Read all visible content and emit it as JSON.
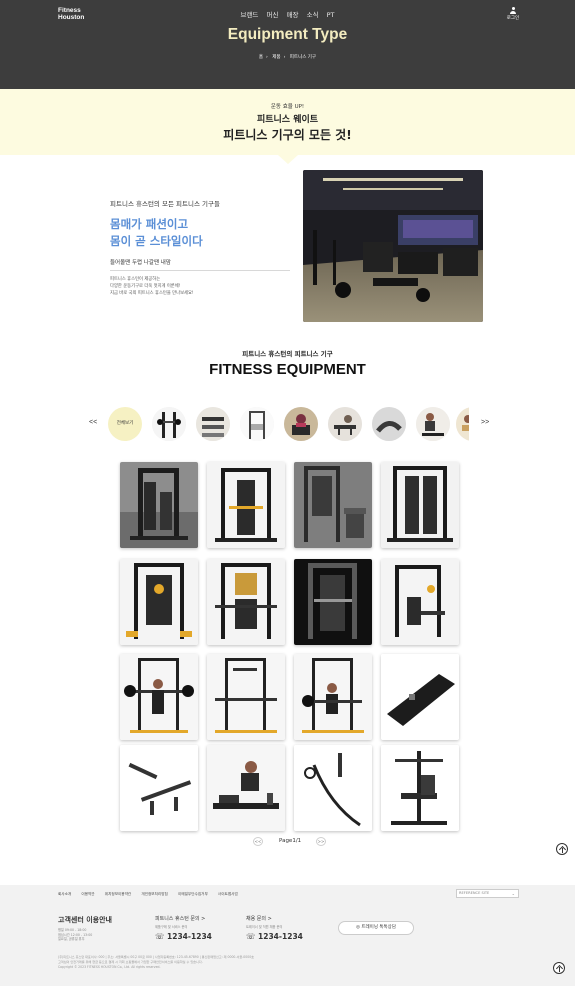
{
  "header": {
    "logo_line1": "Fitness",
    "logo_line2": "Houston",
    "nav": [
      "브랜드",
      "머신",
      "매장",
      "소식",
      "PT"
    ],
    "login_label": "로그인",
    "page_title": "Equipment Type",
    "breadcrumb": [
      "홈",
      "제품",
      "피트니스 기구"
    ]
  },
  "banner": {
    "sub": "운동 효율 UP!",
    "line2": "피트니스 웨이트",
    "line3": "피트니스 기구의 모든 것!"
  },
  "intro": {
    "eyebrow": "피트니스 휴스턴의 모든 피트니스 기구들",
    "headline1": "몸매가 패션이고",
    "headline2": "몸이 곧 스타일이다",
    "tagline": "들어올땐 두렵 나갈땐 내맘",
    "desc1": "피트니스 휴스턴이 제공하는",
    "desc2": "다양한 운동기구로 더욱 멋지게 이룬체!",
    "desc3": "지금 바로 국외 피트니스 휴스턴을 만나보세요!"
  },
  "section": {
    "sub": "피트니스 휴스턴의 피트니스 기구",
    "title": "FITNESS EQUIPMENT"
  },
  "carousel": {
    "prev": "<<",
    "next": ">>",
    "all_label": "전체보기",
    "categories": [
      "smith-machine",
      "dumbbell",
      "power-rack",
      "treadmill",
      "bench",
      "cable",
      "cardio",
      "stretch"
    ]
  },
  "products": [
    "multi-smith-rack-a",
    "functional-trainer",
    "cable-crossover",
    "multi-station-rack",
    "smith-machine-yellow-a",
    "smith-machine-yellow-b",
    "smith-machine-dark",
    "home-gym-station",
    "half-rack-squat-a",
    "half-rack-squat-b",
    "half-rack-squat-c",
    "t-bar-row-platform",
    "landmine-handles",
    "rowing-machine",
    "cable-handle-set",
    "multi-press-bench"
  ],
  "pager": {
    "prev": "<<",
    "label": "Page1/1",
    "next": ">>"
  },
  "footer": {
    "links": [
      "회사소개",
      "이용약관",
      "위치정보이용약관",
      "개인정보처리방침",
      "이메일무단수집거부",
      "사이트맵사업"
    ],
    "reference_select": "REFERENCE SITE",
    "center_title": "고객센터 이용안내",
    "center_info1": "평일 09:00 - 18:00",
    "center_info2": "점심시간 12:00 - 13:00",
    "center_info3": "일요일, 공휴일 휴무",
    "inquiry_title": "피트니스 휴스턴 문의 >",
    "inquiry_sub": "제품구매 및 서비스 문의",
    "inquiry_tel": "1234-1234",
    "recruit_title": "채용 문의 >",
    "recruit_sub": "트레이너 및 직원 채용 문의",
    "recruit_tel": "1234-1234",
    "kakao_label": "트레이닝 톡톡상담",
    "legal1": "(주)피트니스 휴스턴 대표이사: 000   |   주소: 서울특별시 00구 00로 000   |   사업자등록번호: 123-45-67890   |   통신판매업신고: 제 0000-서울-0000호",
    "legal2": "고객님의 안전거래를 위해 현금 등으로 결제 시 저희 쇼핑몰에서 가입한 구매안전서비스를 이용하실 수 있습니다.",
    "copyright": "Copyright © 2023 FITNESS HOUSTON Co., Ltd. All rights reserved."
  },
  "colors": {
    "header_bg": "#3d3d3d",
    "title": "#f3ecc0",
    "banner_bg": "#fdfbe0",
    "accent_blue": "#5b8fd6",
    "footer_bg": "#f2f2f2"
  }
}
